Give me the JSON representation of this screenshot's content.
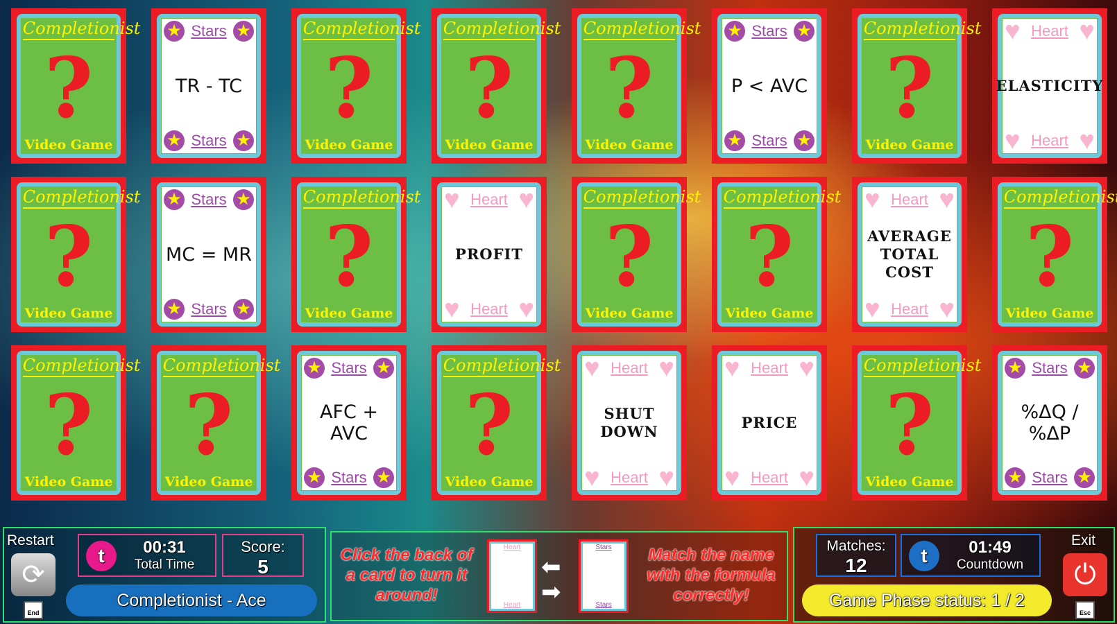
{
  "card_back": {
    "title": "Completionist",
    "symbol": "?",
    "footer": "Video Game"
  },
  "cards": [
    {
      "type": "back"
    },
    {
      "type": "stars",
      "label": "Stars",
      "text": "TR - TC"
    },
    {
      "type": "back"
    },
    {
      "type": "back"
    },
    {
      "type": "back"
    },
    {
      "type": "stars",
      "label": "Stars",
      "text": "P < AVC"
    },
    {
      "type": "back"
    },
    {
      "type": "hearts",
      "label": "Heart",
      "text": "ELASTICITY"
    },
    {
      "type": "back"
    },
    {
      "type": "stars",
      "label": "Stars",
      "text": "MC = MR"
    },
    {
      "type": "back"
    },
    {
      "type": "hearts",
      "label": "Heart",
      "text": "PROFIT"
    },
    {
      "type": "back"
    },
    {
      "type": "back"
    },
    {
      "type": "hearts",
      "label": "Heart",
      "text": "AVERAGE TOTAL COST"
    },
    {
      "type": "back"
    },
    {
      "type": "back"
    },
    {
      "type": "back"
    },
    {
      "type": "stars",
      "label": "Stars",
      "text": "AFC + AVC"
    },
    {
      "type": "back"
    },
    {
      "type": "hearts",
      "label": "Heart",
      "text": "SHUT DOWN"
    },
    {
      "type": "hearts",
      "label": "Heart",
      "text": "PRICE"
    },
    {
      "type": "back"
    },
    {
      "type": "stars",
      "label": "Stars",
      "text": "%ΔQ / %ΔP"
    }
  ],
  "hud": {
    "restart_label": "Restart",
    "end_key": "End",
    "total_time": "00:31",
    "total_time_label": "Total Time",
    "score_label": "Score:",
    "score": "5",
    "rank": "Completionist - Ace",
    "instruction_left": "Click the back of a card to turn it around!",
    "mini_heart": "Heart",
    "mini_stars": "Stars",
    "instruction_right": "Match the name with the formula correctly!",
    "matches_label": "Matches:",
    "matches": "12",
    "countdown": "01:49",
    "countdown_label": "Countdown",
    "phase_status": "Game Phase status: 1 / 2",
    "exit_label": "Exit",
    "esc_key": "Esc"
  }
}
